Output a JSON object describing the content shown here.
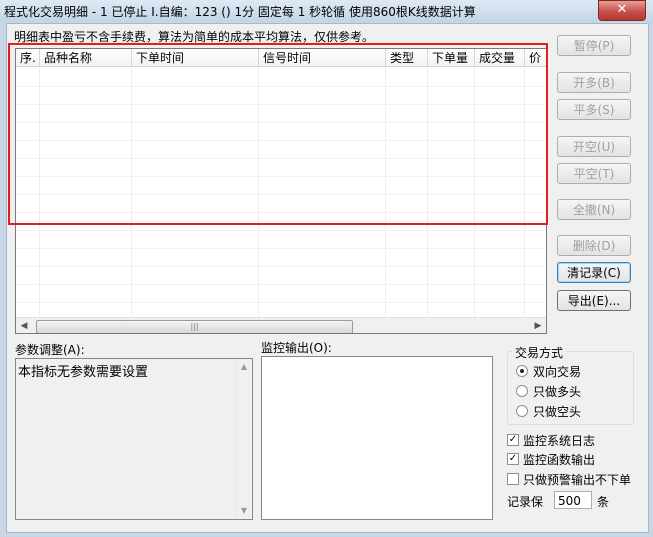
{
  "window": {
    "title": "程式化交易明细 - 1 已停止 I.自编：123 () 1分 固定每 1 秒轮循 使用860根K线数据计算",
    "close_label": "✕"
  },
  "note": "明细表中盈亏不含手续费，算法为简单的成本平均算法，仅供参考。",
  "table": {
    "columns": [
      "序.",
      "品种名称",
      "下单时间",
      "信号时间",
      "类型",
      "下单量",
      "成交量",
      "价"
    ],
    "rows": []
  },
  "buttons": {
    "pause": "暂停(P)",
    "open_long": "开多(B)",
    "close_long": "平多(S)",
    "open_short": "开空(U)",
    "close_short": "平空(T)",
    "cancel_all": "全撤(N)",
    "delete": "删除(D)",
    "clear_records": "清记录(C)",
    "export": "导出(E)..."
  },
  "params": {
    "label": "参数调整(A):",
    "text": "本指标无参数需要设置"
  },
  "output": {
    "label": "监控输出(O):"
  },
  "trade_mode": {
    "title": "交易方式",
    "options": [
      "双向交易",
      "只做多头",
      "只做空头"
    ],
    "selected": "双向交易"
  },
  "checks": {
    "system_log": {
      "label": "监控系统日志",
      "checked": true
    },
    "func_output": {
      "label": "监控函数输出",
      "checked": true
    },
    "warn_only": {
      "label": "只做预警输出不下单",
      "checked": false
    }
  },
  "record": {
    "label_before": "记录保",
    "value": "500",
    "label_after": "条"
  }
}
